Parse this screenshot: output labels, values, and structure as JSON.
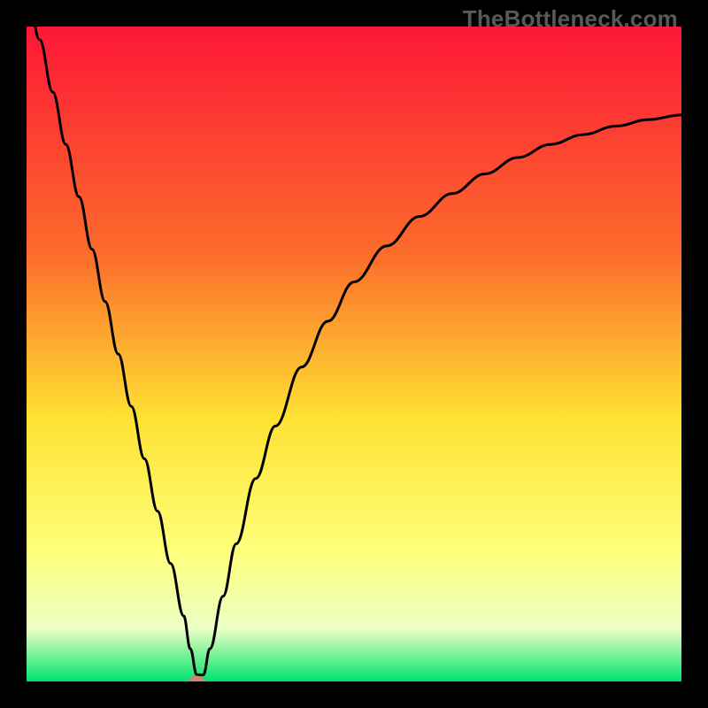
{
  "watermark": "TheBottleneck.com",
  "colors": {
    "frame": "#000000",
    "gradient_top": "#fd1736",
    "gradient_mid_upper": "#fc6d2b",
    "gradient_mid": "#fee233",
    "gradient_mid_lower": "#feff7a",
    "gradient_pale": "#ecffc4",
    "gradient_bottom": "#00e36d",
    "curve": "#000000",
    "min_marker": "#cf8572"
  },
  "chart_data": {
    "type": "line",
    "title": "",
    "xlabel": "",
    "ylabel": "",
    "xlim": [
      0,
      100
    ],
    "ylim": [
      0,
      100
    ],
    "series": [
      {
        "name": "curve",
        "x": [
          0,
          2,
          4,
          6,
          8,
          10,
          12,
          14,
          16,
          18,
          20,
          22,
          24,
          25,
          26,
          27,
          28,
          30,
          32,
          35,
          38,
          42,
          46,
          50,
          55,
          60,
          65,
          70,
          75,
          80,
          85,
          90,
          95,
          100
        ],
        "values": [
          106,
          98,
          90,
          82,
          74,
          66,
          58,
          50,
          42,
          34,
          26,
          18,
          10,
          5,
          1,
          1,
          5,
          13,
          21,
          31,
          39,
          48,
          55,
          61,
          66.5,
          71,
          74.5,
          77.5,
          80,
          82,
          83.5,
          84.8,
          85.8,
          86.5
        ]
      }
    ],
    "min_point": {
      "x": 26,
      "y": 0
    },
    "gradient_stops": [
      {
        "pos": 0,
        "color": "#fd1736"
      },
      {
        "pos": 35,
        "color": "#fc6d2b"
      },
      {
        "pos": 60,
        "color": "#fee233"
      },
      {
        "pos": 80,
        "color": "#feff7a"
      },
      {
        "pos": 92,
        "color": "#ecffc4"
      },
      {
        "pos": 100,
        "color": "#00e36d"
      }
    ]
  }
}
